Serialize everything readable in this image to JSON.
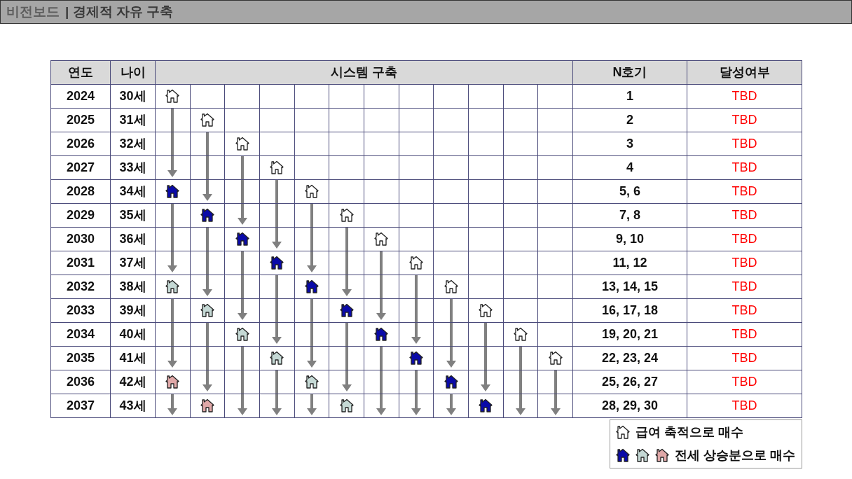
{
  "header": {
    "section": "비전보드",
    "title": "| 경제적 자유 구축"
  },
  "table": {
    "columns": [
      "연도",
      "나이",
      "시스템 구축",
      "N호기",
      "달성여부"
    ],
    "rows": [
      {
        "year": "2024",
        "age": "30세",
        "cells": [
          {
            "kind": "plain"
          },
          {
            "kind": "empty"
          },
          {
            "kind": "empty"
          },
          {
            "kind": "empty"
          },
          {
            "kind": "empty"
          },
          {
            "kind": "empty"
          },
          {
            "kind": "empty"
          },
          {
            "kind": "empty"
          },
          {
            "kind": "empty"
          },
          {
            "kind": "empty"
          },
          {
            "kind": "empty"
          },
          {
            "kind": "empty"
          }
        ],
        "units": "1",
        "status": "TBD"
      },
      {
        "year": "2025",
        "age": "31세",
        "cells": [
          {
            "kind": "line"
          },
          {
            "kind": "plain"
          },
          {
            "kind": "empty"
          },
          {
            "kind": "empty"
          },
          {
            "kind": "empty"
          },
          {
            "kind": "empty"
          },
          {
            "kind": "empty"
          },
          {
            "kind": "empty"
          },
          {
            "kind": "empty"
          },
          {
            "kind": "empty"
          },
          {
            "kind": "empty"
          },
          {
            "kind": "empty"
          }
        ],
        "units": "2",
        "status": "TBD"
      },
      {
        "year": "2026",
        "age": "32세",
        "cells": [
          {
            "kind": "line"
          },
          {
            "kind": "line"
          },
          {
            "kind": "plain"
          },
          {
            "kind": "empty"
          },
          {
            "kind": "empty"
          },
          {
            "kind": "empty"
          },
          {
            "kind": "empty"
          },
          {
            "kind": "empty"
          },
          {
            "kind": "empty"
          },
          {
            "kind": "empty"
          },
          {
            "kind": "empty"
          },
          {
            "kind": "empty"
          }
        ],
        "units": "3",
        "status": "TBD"
      },
      {
        "year": "2027",
        "age": "33세",
        "cells": [
          {
            "kind": "arrow"
          },
          {
            "kind": "line"
          },
          {
            "kind": "line"
          },
          {
            "kind": "plain"
          },
          {
            "kind": "empty"
          },
          {
            "kind": "empty"
          },
          {
            "kind": "empty"
          },
          {
            "kind": "empty"
          },
          {
            "kind": "empty"
          },
          {
            "kind": "empty"
          },
          {
            "kind": "empty"
          },
          {
            "kind": "empty"
          }
        ],
        "units": "4",
        "status": "TBD"
      },
      {
        "year": "2028",
        "age": "34세",
        "cells": [
          {
            "kind": "blue"
          },
          {
            "kind": "arrow"
          },
          {
            "kind": "line"
          },
          {
            "kind": "line"
          },
          {
            "kind": "plain"
          },
          {
            "kind": "empty"
          },
          {
            "kind": "empty"
          },
          {
            "kind": "empty"
          },
          {
            "kind": "empty"
          },
          {
            "kind": "empty"
          },
          {
            "kind": "empty"
          },
          {
            "kind": "empty"
          }
        ],
        "units": "5, 6",
        "status": "TBD"
      },
      {
        "year": "2029",
        "age": "35세",
        "cells": [
          {
            "kind": "line"
          },
          {
            "kind": "blue"
          },
          {
            "kind": "arrow"
          },
          {
            "kind": "line"
          },
          {
            "kind": "line"
          },
          {
            "kind": "plain"
          },
          {
            "kind": "empty"
          },
          {
            "kind": "empty"
          },
          {
            "kind": "empty"
          },
          {
            "kind": "empty"
          },
          {
            "kind": "empty"
          },
          {
            "kind": "empty"
          }
        ],
        "units": "7, 8",
        "status": "TBD"
      },
      {
        "year": "2030",
        "age": "36세",
        "cells": [
          {
            "kind": "line"
          },
          {
            "kind": "line"
          },
          {
            "kind": "blue"
          },
          {
            "kind": "arrow"
          },
          {
            "kind": "line"
          },
          {
            "kind": "line"
          },
          {
            "kind": "plain"
          },
          {
            "kind": "empty"
          },
          {
            "kind": "empty"
          },
          {
            "kind": "empty"
          },
          {
            "kind": "empty"
          },
          {
            "kind": "empty"
          }
        ],
        "units": "9, 10",
        "status": "TBD"
      },
      {
        "year": "2031",
        "age": "37세",
        "cells": [
          {
            "kind": "arrow"
          },
          {
            "kind": "line"
          },
          {
            "kind": "line"
          },
          {
            "kind": "blue"
          },
          {
            "kind": "arrow"
          },
          {
            "kind": "line"
          },
          {
            "kind": "line"
          },
          {
            "kind": "plain"
          },
          {
            "kind": "empty"
          },
          {
            "kind": "empty"
          },
          {
            "kind": "empty"
          },
          {
            "kind": "empty"
          }
        ],
        "units": "11, 12",
        "status": "TBD"
      },
      {
        "year": "2032",
        "age": "38세",
        "cells": [
          {
            "kind": "teal"
          },
          {
            "kind": "arrow"
          },
          {
            "kind": "line"
          },
          {
            "kind": "line"
          },
          {
            "kind": "blue"
          },
          {
            "kind": "arrow"
          },
          {
            "kind": "line"
          },
          {
            "kind": "line"
          },
          {
            "kind": "plain"
          },
          {
            "kind": "empty"
          },
          {
            "kind": "empty"
          },
          {
            "kind": "empty"
          }
        ],
        "units": "13, 14, 15",
        "status": "TBD"
      },
      {
        "year": "2033",
        "age": "39세",
        "cells": [
          {
            "kind": "line"
          },
          {
            "kind": "teal"
          },
          {
            "kind": "arrow"
          },
          {
            "kind": "line"
          },
          {
            "kind": "line"
          },
          {
            "kind": "blue"
          },
          {
            "kind": "arrow"
          },
          {
            "kind": "line"
          },
          {
            "kind": "line"
          },
          {
            "kind": "plain"
          },
          {
            "kind": "empty"
          },
          {
            "kind": "empty"
          }
        ],
        "units": "16, 17, 18",
        "status": "TBD"
      },
      {
        "year": "2034",
        "age": "40세",
        "cells": [
          {
            "kind": "line"
          },
          {
            "kind": "line"
          },
          {
            "kind": "teal"
          },
          {
            "kind": "arrow"
          },
          {
            "kind": "line"
          },
          {
            "kind": "line"
          },
          {
            "kind": "blue"
          },
          {
            "kind": "arrow"
          },
          {
            "kind": "line"
          },
          {
            "kind": "line"
          },
          {
            "kind": "plain"
          },
          {
            "kind": "empty"
          }
        ],
        "units": "19, 20, 21",
        "status": "TBD"
      },
      {
        "year": "2035",
        "age": "41세",
        "cells": [
          {
            "kind": "arrow"
          },
          {
            "kind": "line"
          },
          {
            "kind": "line"
          },
          {
            "kind": "teal"
          },
          {
            "kind": "arrow"
          },
          {
            "kind": "line"
          },
          {
            "kind": "line"
          },
          {
            "kind": "blue"
          },
          {
            "kind": "arrow"
          },
          {
            "kind": "line"
          },
          {
            "kind": "line"
          },
          {
            "kind": "plain"
          }
        ],
        "units": "22, 23, 24",
        "status": "TBD"
      },
      {
        "year": "2036",
        "age": "42세",
        "cells": [
          {
            "kind": "pink"
          },
          {
            "kind": "arrow"
          },
          {
            "kind": "line"
          },
          {
            "kind": "line"
          },
          {
            "kind": "teal"
          },
          {
            "kind": "arrow"
          },
          {
            "kind": "line"
          },
          {
            "kind": "line"
          },
          {
            "kind": "blue"
          },
          {
            "kind": "arrow"
          },
          {
            "kind": "line"
          },
          {
            "kind": "line"
          }
        ],
        "units": "25, 26, 27",
        "status": "TBD"
      },
      {
        "year": "2037",
        "age": "43세",
        "cells": [
          {
            "kind": "arrow"
          },
          {
            "kind": "pink"
          },
          {
            "kind": "arrow"
          },
          {
            "kind": "arrow"
          },
          {
            "kind": "arrow"
          },
          {
            "kind": "teal"
          },
          {
            "kind": "arrow"
          },
          {
            "kind": "arrow"
          },
          {
            "kind": "arrow"
          },
          {
            "kind": "blue"
          },
          {
            "kind": "arrow"
          },
          {
            "kind": "arrow"
          }
        ],
        "units": "28, 29, 30",
        "status": "TBD"
      }
    ]
  },
  "legend": [
    {
      "houses": [
        {
          "kind": "plain"
        }
      ],
      "label": "급여 축적으로 매수"
    },
    {
      "houses": [
        {
          "kind": "blue"
        },
        {
          "kind": "teal"
        },
        {
          "kind": "pink"
        }
      ],
      "label": "전세 상승분으로 매수"
    }
  ]
}
